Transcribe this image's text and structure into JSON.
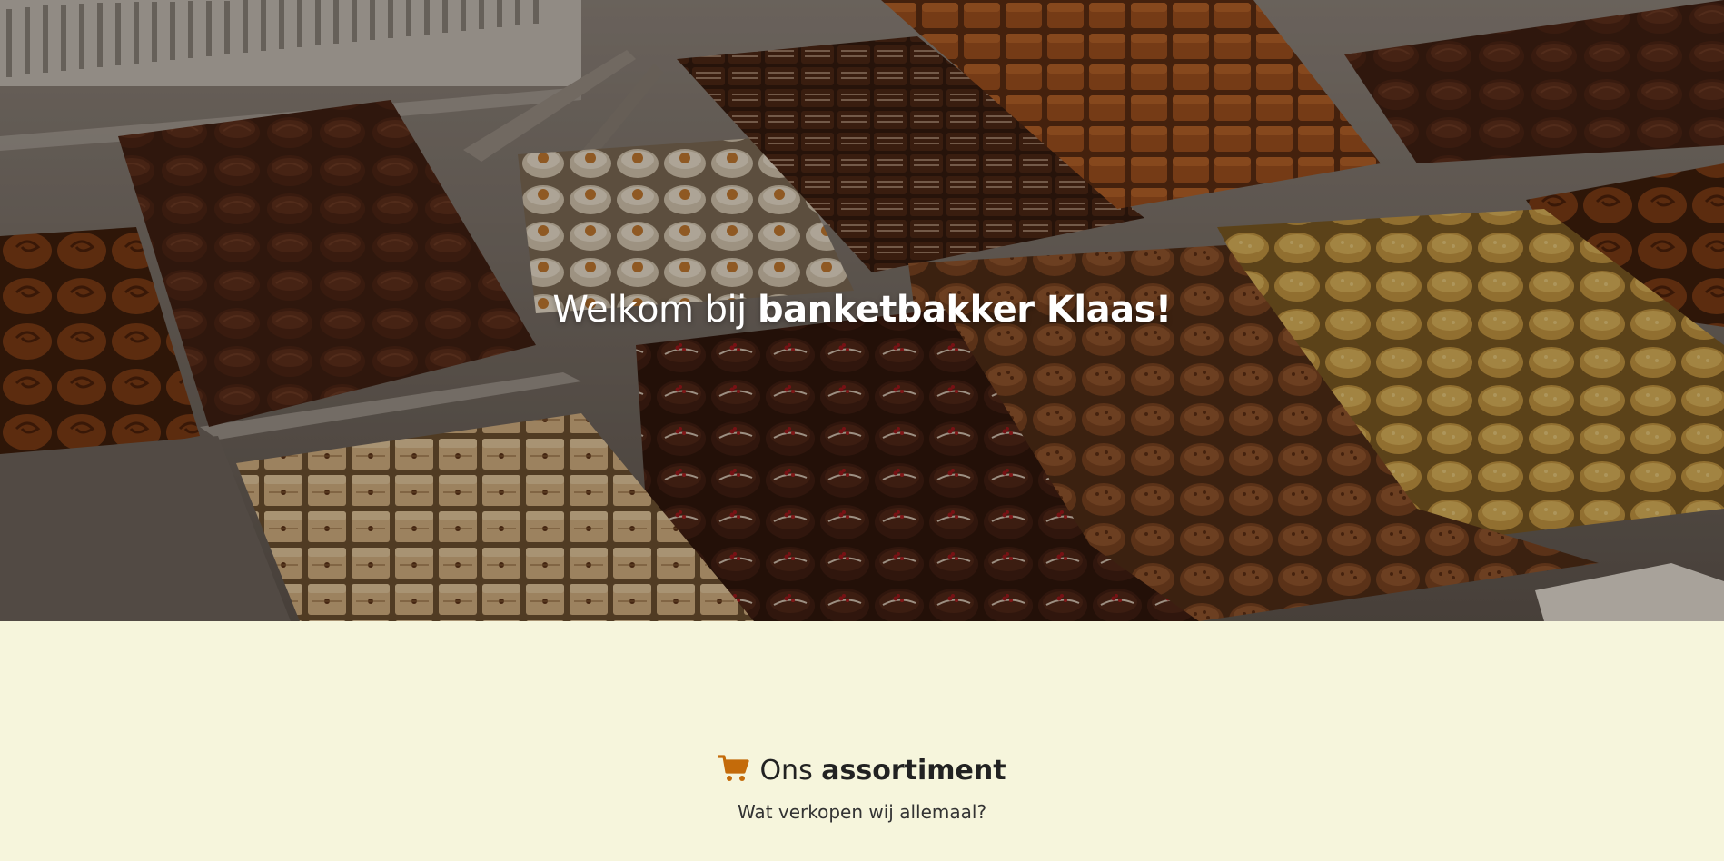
{
  "hero": {
    "title_light": "Welkom bij",
    "title_bold": "banketbakker Klaas!",
    "image": "chocolate-pralines-display"
  },
  "assortiment": {
    "icon": "shopping-cart-icon",
    "title_light": "Ons",
    "title_bold": "assortiment",
    "subtitle": "Wat verkopen wij allemaal?"
  },
  "colors": {
    "background": "#f6f5dc",
    "accent": "#c46b0a",
    "text_dark": "#222222",
    "hero_text": "#ffffff"
  }
}
